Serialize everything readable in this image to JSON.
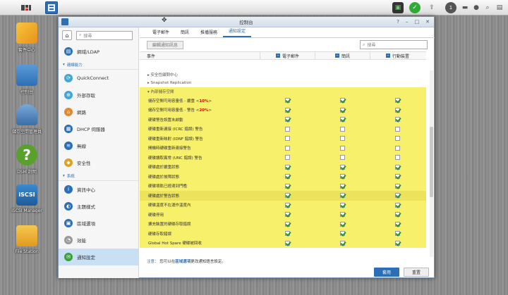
{
  "taskbar": {
    "active_app": "控制台"
  },
  "desktop": [
    {
      "label": "套件中心",
      "color": "#f0b428"
    },
    {
      "label": "控制台",
      "color": "#3a7bc8"
    },
    {
      "label": "儲存空間管理員",
      "color": "#4a86c8"
    },
    {
      "label": "DSM 說明",
      "color": "#5aa02c"
    },
    {
      "label": "iSCSI Manager",
      "color": "#2e78c0"
    },
    {
      "label": "File Station",
      "color": "#e8a830"
    }
  ],
  "window": {
    "title": "控制台"
  },
  "sidebar": {
    "search_placeholder": "搜尋",
    "items_top": [
      {
        "label": "網域/LDAP",
        "color": "#2d6fb5",
        "glyph": "▤"
      }
    ],
    "heads": [
      "連線能力",
      "系統"
    ],
    "items_conn": [
      {
        "label": "QuickConnect",
        "color": "#41a7d8",
        "glyph": "⟳"
      },
      {
        "label": "外部存取",
        "color": "#41a7d8",
        "glyph": "⊕"
      },
      {
        "label": "網路",
        "color": "#e08a2c",
        "glyph": "⌂"
      },
      {
        "label": "DHCP 伺服器",
        "color": "#2d6fb5",
        "glyph": "▦"
      },
      {
        "label": "無線",
        "color": "#2d6fb5",
        "glyph": "≋"
      },
      {
        "label": "安全性",
        "color": "#e0a020",
        "glyph": "◆"
      }
    ],
    "items_sys": [
      {
        "label": "資訊中心",
        "color": "#2d6fb5",
        "glyph": "i"
      },
      {
        "label": "主題樣式",
        "color": "#2d6fb5",
        "glyph": "◐"
      },
      {
        "label": "區域選項",
        "color": "#2d6fb5",
        "glyph": "▣"
      },
      {
        "label": "效能",
        "color": "#999999",
        "glyph": "◔"
      },
      {
        "label": "通知設定",
        "color": "#3aa03a",
        "glyph": "✉"
      }
    ]
  },
  "tabs": [
    "電子郵件",
    "簡訊",
    "推播服務",
    "通知設定"
  ],
  "toolbar": {
    "edit_label": "編輯通知訊息",
    "search_placeholder": "搜尋"
  },
  "table": {
    "col_event": "事件",
    "col_email": "電子郵件",
    "col_sms": "簡訊",
    "col_mobile": "行動裝置",
    "groups": [
      {
        "label": "安全性顧問中心",
        "collapsed": true
      },
      {
        "label": "Snapshot Replication",
        "collapsed": true
      },
      {
        "label": "內部儲存空間",
        "collapsed": false
      }
    ],
    "rows": [
      {
        "pre": "儲存空間可用容量低 - 嚴重 <",
        "red": "10%",
        "post": ">",
        "email": true,
        "sms": true,
        "mobile": true
      },
      {
        "pre": "儲存空間可用容量低 - 警告 <",
        "red": "20%",
        "post": ">",
        "email": true,
        "sms": true,
        "mobile": true
      },
      {
        "pre": "硬碟警告設置未啟動",
        "red": "",
        "post": "",
        "email": true,
        "sms": true,
        "mobile": true
      },
      {
        "pre": "硬碟重新連接 (ICRC 錯誤) 警告",
        "red": "",
        "post": "",
        "email": false,
        "sms": false,
        "mobile": false
      },
      {
        "pre": "硬碟重新映射 (IDNF 錯誤) 警告",
        "red": "",
        "post": "",
        "email": false,
        "sms": false,
        "mobile": false
      },
      {
        "pre": "開機時硬碟重新連接警告",
        "red": "",
        "post": "",
        "email": false,
        "sms": false,
        "mobile": false
      },
      {
        "pre": "硬碟讀取異常 (UNC 錯誤) 警告",
        "red": "",
        "post": "",
        "email": false,
        "sms": false,
        "mobile": false
      },
      {
        "pre": "硬碟處於嚴重狀態",
        "red": "",
        "post": "",
        "email": true,
        "sms": true,
        "mobile": true
      },
      {
        "pre": "硬碟處於故障狀態",
        "red": "",
        "post": "",
        "email": true,
        "sms": true,
        "mobile": true
      },
      {
        "pre": "硬碟壞軌已經達到門檻",
        "red": "",
        "post": "",
        "email": true,
        "sms": true,
        "mobile": true
      },
      {
        "pre": "硬碟處於警告狀態",
        "red": "",
        "post": "",
        "email": true,
        "sms": true,
        "mobile": true,
        "selected": true
      },
      {
        "pre": "硬碟溫度不在運作溫度內",
        "red": "",
        "post": "",
        "email": true,
        "sms": true,
        "mobile": true
      },
      {
        "pre": "硬碟停用",
        "red": "",
        "post": "",
        "email": true,
        "sms": true,
        "mobile": true
      },
      {
        "pre": "擴充裝置的硬碟存取錯誤",
        "red": "",
        "post": "",
        "email": true,
        "sms": true,
        "mobile": true
      },
      {
        "pre": "硬碟存取錯誤",
        "red": "",
        "post": "",
        "email": true,
        "sms": true,
        "mobile": true
      },
      {
        "pre": "Global Hot Spare 硬碟被回收",
        "red": "",
        "post": "",
        "email": true,
        "sms": true,
        "mobile": true
      }
    ]
  },
  "note": {
    "label": "注意：",
    "pre": "您可以在",
    "link": "區域選項",
    "post": "更改通知語言設定。"
  },
  "footer": {
    "apply": "套用",
    "reset": "重置"
  }
}
